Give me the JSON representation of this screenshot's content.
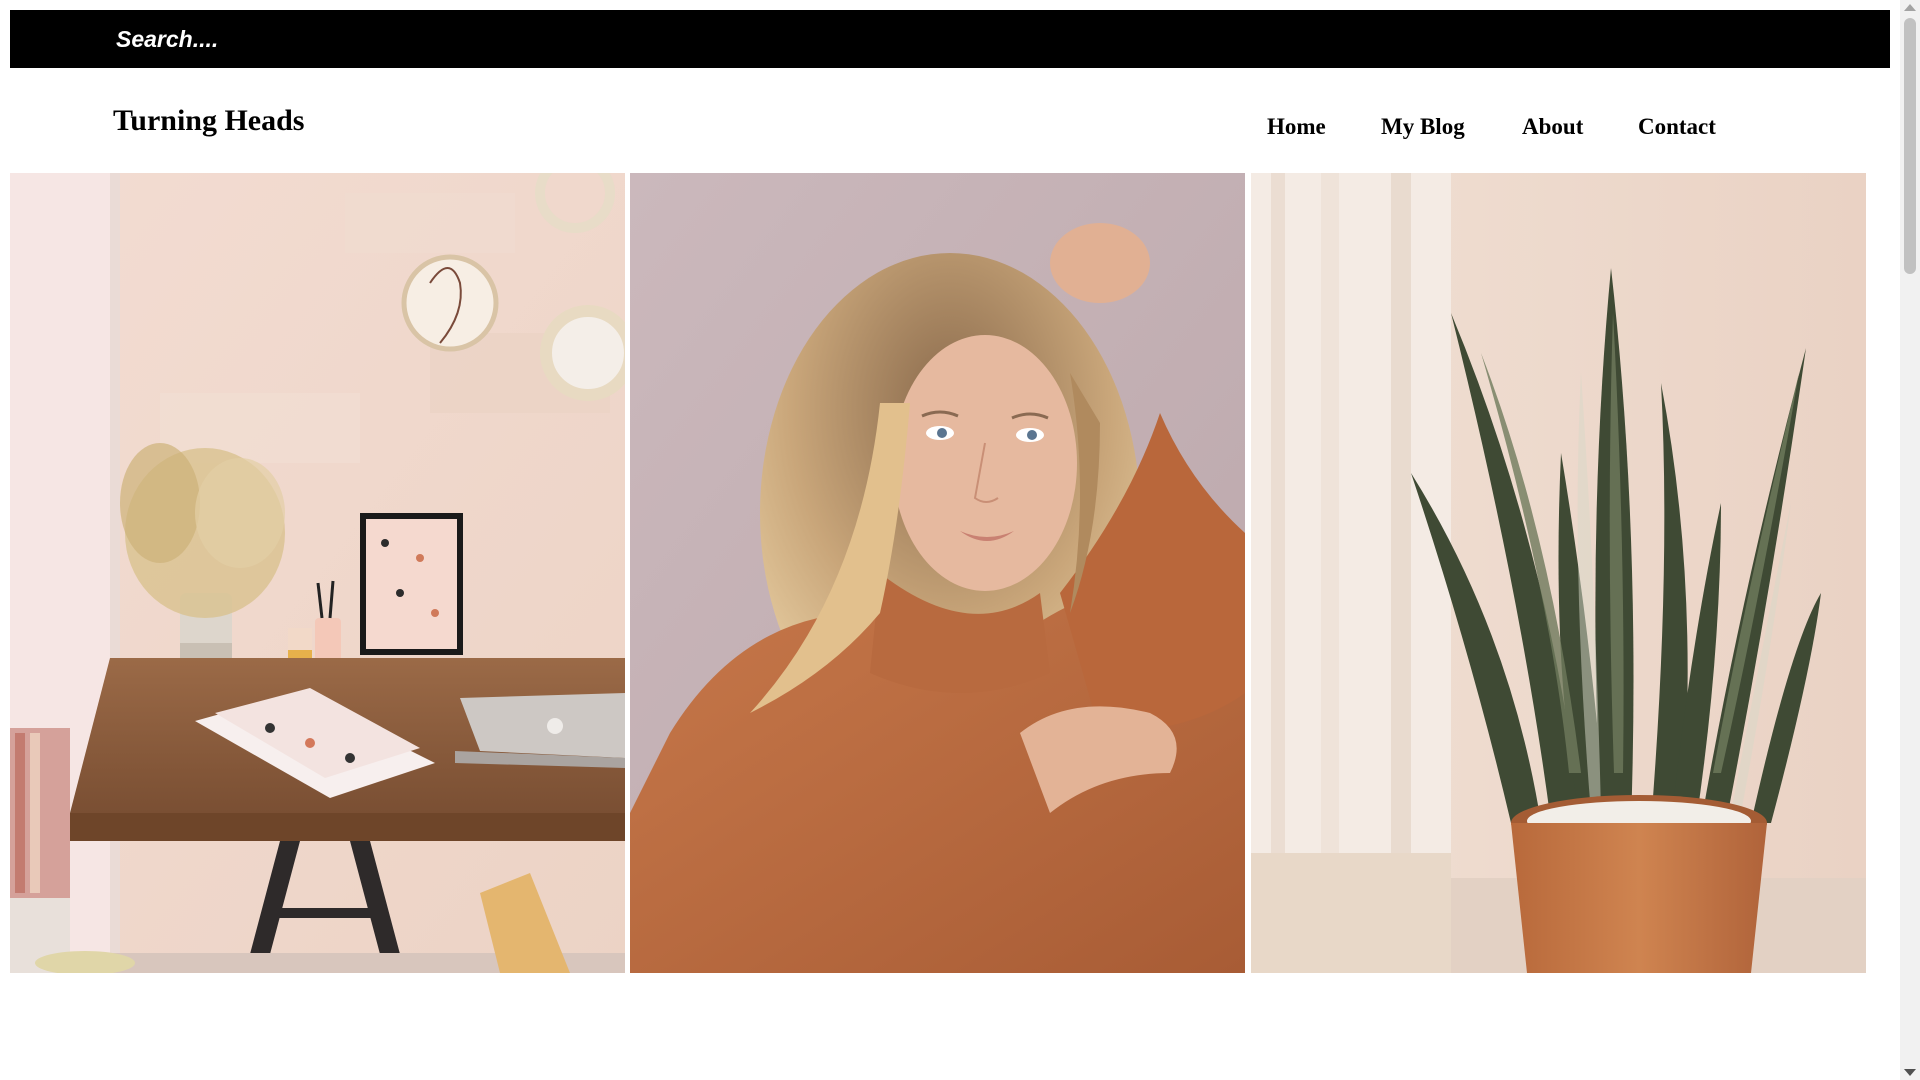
{
  "topbar": {
    "search_placeholder": "Search....",
    "social_icons": [
      "facebook-icon",
      "instagram-icon",
      "twitter-icon",
      "pinterest-icon"
    ]
  },
  "header": {
    "brand": "Turning Heads",
    "nav": [
      "Home",
      "My Blog",
      "About",
      "Contact"
    ]
  },
  "gallery": {
    "photos": [
      "workspace-desk",
      "woman-in-orange-sweater",
      "snake-plant-in-pot"
    ]
  },
  "colors": {
    "topbar_bg": "#000000",
    "text": "#000000",
    "accent_terracotta": "#c8794a"
  }
}
